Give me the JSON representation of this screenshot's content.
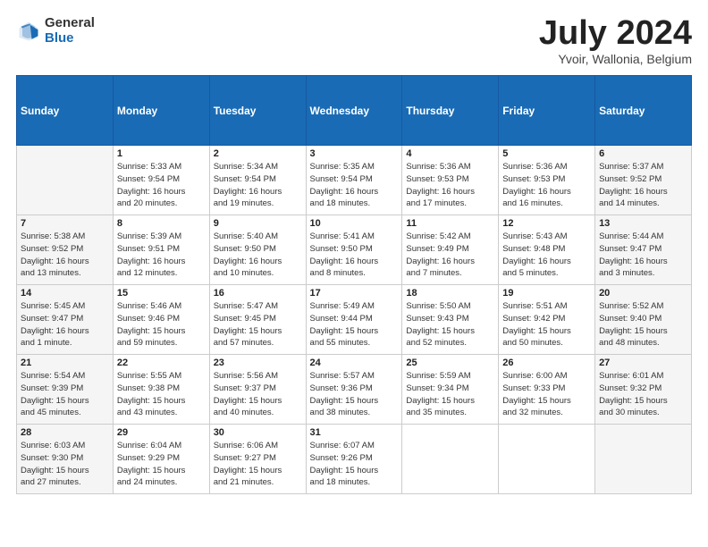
{
  "header": {
    "logo_general": "General",
    "logo_blue": "Blue",
    "month_title": "July 2024",
    "location": "Yvoir, Wallonia, Belgium"
  },
  "calendar": {
    "days_of_week": [
      "Sunday",
      "Monday",
      "Tuesday",
      "Wednesday",
      "Thursday",
      "Friday",
      "Saturday"
    ],
    "weeks": [
      [
        {
          "day": "",
          "info": ""
        },
        {
          "day": "1",
          "info": "Sunrise: 5:33 AM\nSunset: 9:54 PM\nDaylight: 16 hours\nand 20 minutes."
        },
        {
          "day": "2",
          "info": "Sunrise: 5:34 AM\nSunset: 9:54 PM\nDaylight: 16 hours\nand 19 minutes."
        },
        {
          "day": "3",
          "info": "Sunrise: 5:35 AM\nSunset: 9:54 PM\nDaylight: 16 hours\nand 18 minutes."
        },
        {
          "day": "4",
          "info": "Sunrise: 5:36 AM\nSunset: 9:53 PM\nDaylight: 16 hours\nand 17 minutes."
        },
        {
          "day": "5",
          "info": "Sunrise: 5:36 AM\nSunset: 9:53 PM\nDaylight: 16 hours\nand 16 minutes."
        },
        {
          "day": "6",
          "info": "Sunrise: 5:37 AM\nSunset: 9:52 PM\nDaylight: 16 hours\nand 14 minutes."
        }
      ],
      [
        {
          "day": "7",
          "info": "Sunrise: 5:38 AM\nSunset: 9:52 PM\nDaylight: 16 hours\nand 13 minutes."
        },
        {
          "day": "8",
          "info": "Sunrise: 5:39 AM\nSunset: 9:51 PM\nDaylight: 16 hours\nand 12 minutes."
        },
        {
          "day": "9",
          "info": "Sunrise: 5:40 AM\nSunset: 9:50 PM\nDaylight: 16 hours\nand 10 minutes."
        },
        {
          "day": "10",
          "info": "Sunrise: 5:41 AM\nSunset: 9:50 PM\nDaylight: 16 hours\nand 8 minutes."
        },
        {
          "day": "11",
          "info": "Sunrise: 5:42 AM\nSunset: 9:49 PM\nDaylight: 16 hours\nand 7 minutes."
        },
        {
          "day": "12",
          "info": "Sunrise: 5:43 AM\nSunset: 9:48 PM\nDaylight: 16 hours\nand 5 minutes."
        },
        {
          "day": "13",
          "info": "Sunrise: 5:44 AM\nSunset: 9:47 PM\nDaylight: 16 hours\nand 3 minutes."
        }
      ],
      [
        {
          "day": "14",
          "info": "Sunrise: 5:45 AM\nSunset: 9:47 PM\nDaylight: 16 hours\nand 1 minute."
        },
        {
          "day": "15",
          "info": "Sunrise: 5:46 AM\nSunset: 9:46 PM\nDaylight: 15 hours\nand 59 minutes."
        },
        {
          "day": "16",
          "info": "Sunrise: 5:47 AM\nSunset: 9:45 PM\nDaylight: 15 hours\nand 57 minutes."
        },
        {
          "day": "17",
          "info": "Sunrise: 5:49 AM\nSunset: 9:44 PM\nDaylight: 15 hours\nand 55 minutes."
        },
        {
          "day": "18",
          "info": "Sunrise: 5:50 AM\nSunset: 9:43 PM\nDaylight: 15 hours\nand 52 minutes."
        },
        {
          "day": "19",
          "info": "Sunrise: 5:51 AM\nSunset: 9:42 PM\nDaylight: 15 hours\nand 50 minutes."
        },
        {
          "day": "20",
          "info": "Sunrise: 5:52 AM\nSunset: 9:40 PM\nDaylight: 15 hours\nand 48 minutes."
        }
      ],
      [
        {
          "day": "21",
          "info": "Sunrise: 5:54 AM\nSunset: 9:39 PM\nDaylight: 15 hours\nand 45 minutes."
        },
        {
          "day": "22",
          "info": "Sunrise: 5:55 AM\nSunset: 9:38 PM\nDaylight: 15 hours\nand 43 minutes."
        },
        {
          "day": "23",
          "info": "Sunrise: 5:56 AM\nSunset: 9:37 PM\nDaylight: 15 hours\nand 40 minutes."
        },
        {
          "day": "24",
          "info": "Sunrise: 5:57 AM\nSunset: 9:36 PM\nDaylight: 15 hours\nand 38 minutes."
        },
        {
          "day": "25",
          "info": "Sunrise: 5:59 AM\nSunset: 9:34 PM\nDaylight: 15 hours\nand 35 minutes."
        },
        {
          "day": "26",
          "info": "Sunrise: 6:00 AM\nSunset: 9:33 PM\nDaylight: 15 hours\nand 32 minutes."
        },
        {
          "day": "27",
          "info": "Sunrise: 6:01 AM\nSunset: 9:32 PM\nDaylight: 15 hours\nand 30 minutes."
        }
      ],
      [
        {
          "day": "28",
          "info": "Sunrise: 6:03 AM\nSunset: 9:30 PM\nDaylight: 15 hours\nand 27 minutes."
        },
        {
          "day": "29",
          "info": "Sunrise: 6:04 AM\nSunset: 9:29 PM\nDaylight: 15 hours\nand 24 minutes."
        },
        {
          "day": "30",
          "info": "Sunrise: 6:06 AM\nSunset: 9:27 PM\nDaylight: 15 hours\nand 21 minutes."
        },
        {
          "day": "31",
          "info": "Sunrise: 6:07 AM\nSunset: 9:26 PM\nDaylight: 15 hours\nand 18 minutes."
        },
        {
          "day": "",
          "info": ""
        },
        {
          "day": "",
          "info": ""
        },
        {
          "day": "",
          "info": ""
        }
      ]
    ]
  }
}
